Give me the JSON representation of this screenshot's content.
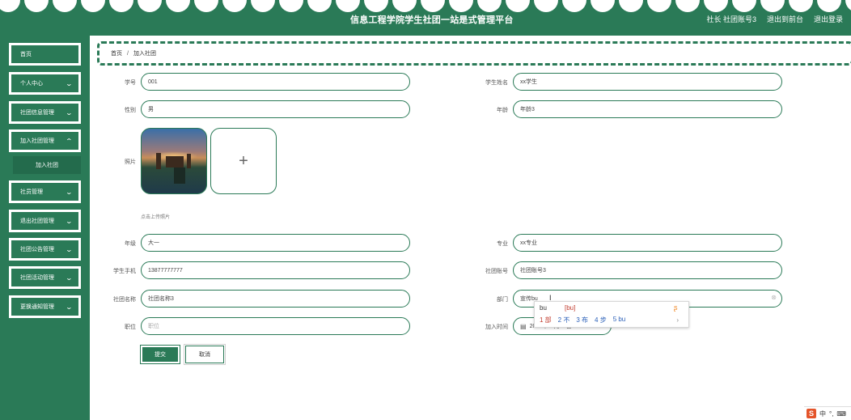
{
  "header": {
    "title": "信息工程学院学生社团一站是式管理平台",
    "role_user": "社长 社团账号3",
    "goto_front": "退出到前台",
    "logout": "退出登录"
  },
  "sidebar": {
    "items": [
      {
        "label": "首页"
      },
      {
        "label": "个人中心"
      },
      {
        "label": "社团信息管理"
      },
      {
        "label": "加入社团管理"
      },
      {
        "label": "社员管理"
      },
      {
        "label": "退出社团管理"
      },
      {
        "label": "社团公告管理"
      },
      {
        "label": "社团活动管理"
      },
      {
        "label": "更换通知管理"
      }
    ],
    "submenu_label": "加入社团"
  },
  "breadcrumb": {
    "home": "首页",
    "separator": "/",
    "current": "加入社团"
  },
  "form": {
    "student_no_label": "学号",
    "student_no_value": "001",
    "student_name_label": "学生姓名",
    "student_name_value": "xx学生",
    "gender_label": "性别",
    "gender_value": "男",
    "age_label": "年龄",
    "age_value": "年龄3",
    "photo_label": "照片",
    "upload_plus": "+",
    "upload_hint": "点击上传照片",
    "grade_label": "年级",
    "grade_value": "大一",
    "major_label": "专业",
    "major_value": "xx专业",
    "phone_label": "学生手机",
    "phone_value": "13877777777",
    "club_account_label": "社团账号",
    "club_account_value": "社团账号3",
    "club_name_label": "社团名称",
    "club_name_value": "社团名称3",
    "department_label": "部门",
    "department_value": "宣传bu",
    "position_label": "职位",
    "position_placeholder": "职位",
    "join_time_label": "加入时间",
    "join_time_value": "2022年03月18日",
    "submit_label": "提交",
    "cancel_label": "取消"
  },
  "ime": {
    "composition": "bu",
    "pinyin": "[bu]",
    "candidates": [
      "1 部",
      "2 不",
      "3 布",
      "4 步",
      "5 bu"
    ],
    "next": "›"
  },
  "tray": {
    "ime_logo": "S",
    "lang": "中",
    "punct": "°,",
    "extra": "⌨"
  },
  "colors": {
    "primary": "#2a7a57",
    "background": "#ffffff"
  }
}
